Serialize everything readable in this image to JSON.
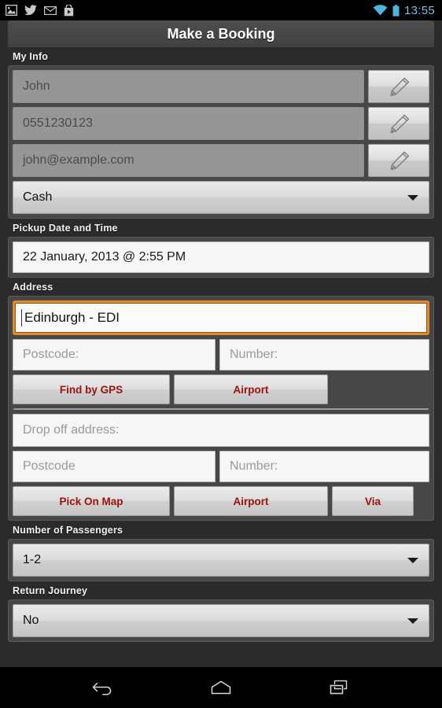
{
  "statusbar": {
    "left_icons": [
      "photo-icon",
      "twitter-icon",
      "email-icon",
      "play-store-icon"
    ],
    "wifi_icon": "wifi-icon",
    "battery_icon": "battery-icon",
    "time": "13:55",
    "time_color": "#6fc4e8"
  },
  "titlebar": {
    "title": "Make a Booking"
  },
  "my_info": {
    "label": "My Info",
    "name_value": "John",
    "phone_value": "0551230123",
    "email_value": "john@example.com",
    "edit_icon": "pencil-icon",
    "payment_value": "Cash",
    "caret_icon": "chevron-down-icon"
  },
  "pickup_datetime": {
    "label": "Pickup Date and Time",
    "value": "22 January, 2013 @ 2:55 PM"
  },
  "address": {
    "label": "Address",
    "pickup_value": "Edinburgh - EDI",
    "pickup_focused": true,
    "pickup_postcode_placeholder": "Postcode:",
    "pickup_number_placeholder": "Number:",
    "find_by_gps_label": "Find by GPS",
    "pickup_airport_label": "Airport",
    "dropoff_placeholder": "Drop off address:",
    "dropoff_postcode_placeholder": "Postcode",
    "dropoff_number_placeholder": "Number:",
    "pick_on_map_label": "Pick On Map",
    "dropoff_airport_label": "Airport",
    "via_label": "Via",
    "button_text_color": "#9d1010",
    "focus_border_color": "#e08b2c"
  },
  "passengers": {
    "label": "Number of Passengers",
    "value": "1-2"
  },
  "return_journey": {
    "label": "Return Journey",
    "value": "No"
  },
  "navbar": {
    "back_label": "Back",
    "home_label": "Home",
    "recents_label": "Recent apps"
  }
}
